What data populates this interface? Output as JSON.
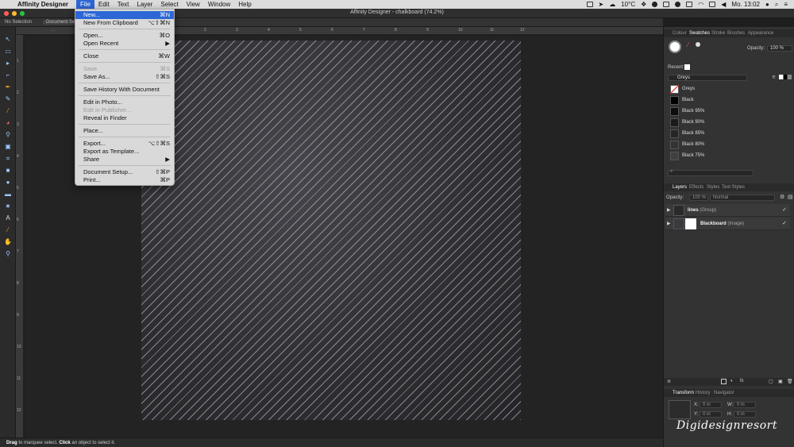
{
  "menubar": {
    "app_name": "Affinity Designer",
    "menus": [
      "File",
      "Edit",
      "Text",
      "Layer",
      "Select",
      "View",
      "Window",
      "Help"
    ],
    "temperature": "10°C",
    "clock": "Mo. 13:02"
  },
  "window": {
    "title": "Affinity Designer - chalkboard (74.2%)"
  },
  "context_toolbar": {
    "selection": "No Selection",
    "doc_setup": "Document Setup"
  },
  "file_menu": {
    "items": [
      {
        "label": "New...",
        "shortcut": "⌘N",
        "highlighted": true
      },
      {
        "label": "New From Clipboard",
        "shortcut": "⌥⇧⌘N"
      },
      {
        "label": "Open...",
        "shortcut": "⌘O"
      },
      {
        "label": "Open Recent",
        "shortcut": "▶"
      },
      {
        "label": "Close",
        "shortcut": "⌘W"
      },
      {
        "label": "Save",
        "shortcut": "⌘S",
        "disabled": true
      },
      {
        "label": "Save As...",
        "shortcut": "⇧⌘S"
      },
      {
        "label": "Save History With Document",
        "shortcut": ""
      },
      {
        "label": "Edit in Photo...",
        "shortcut": ""
      },
      {
        "label": "Edit in Publisher...",
        "shortcut": "",
        "disabled": true
      },
      {
        "label": "Reveal in Finder",
        "shortcut": ""
      },
      {
        "label": "Place...",
        "shortcut": ""
      },
      {
        "label": "Export...",
        "shortcut": "⌥⇧⌘S"
      },
      {
        "label": "Export as Template...",
        "shortcut": ""
      },
      {
        "label": "Share",
        "shortcut": "▶"
      },
      {
        "label": "Document Setup...",
        "shortcut": "⇧⌘P"
      },
      {
        "label": "Print...",
        "shortcut": "⌘P"
      }
    ]
  },
  "ruler": {
    "marks": [
      "1",
      "2",
      "3",
      "4",
      "5",
      "6",
      "7",
      "8",
      "9",
      "10",
      "11",
      "12"
    ]
  },
  "swatches_panel": {
    "tabs": [
      "Colour",
      "Swatches",
      "Stroke",
      "Brushes",
      "Appearance"
    ],
    "opacity_label": "Opacity:",
    "opacity_value": "100 %",
    "recent_label": "Recent:",
    "palette": "Greys",
    "swatches": [
      {
        "name": "Greys",
        "color": "#ffffff"
      },
      {
        "name": "Black",
        "color": "#000000"
      },
      {
        "name": "Black 95%",
        "color": "#0d0d0d"
      },
      {
        "name": "Black 90%",
        "color": "#1a1a1a"
      },
      {
        "name": "Black 85%",
        "color": "#262626"
      },
      {
        "name": "Black 80%",
        "color": "#333333"
      },
      {
        "name": "Black 75%",
        "color": "#404040"
      }
    ]
  },
  "layers_panel": {
    "tabs": [
      "Layers",
      "Effects",
      "Styles",
      "Text Styles"
    ],
    "opacity_label": "Opacity:",
    "opacity_value": "100 %",
    "blend_mode": "Normal",
    "layers": [
      {
        "name": "lines",
        "kind": "(Group)"
      },
      {
        "name": "Blackboard",
        "kind": "(Image)"
      }
    ]
  },
  "transform_panel": {
    "tabs": [
      "Transform",
      "History",
      "Navigator"
    ],
    "fields": [
      {
        "label": "X:",
        "value": "0 in"
      },
      {
        "label": "W:",
        "value": "0 in"
      },
      {
        "label": "Y:",
        "value": "0 in"
      },
      {
        "label": "H:",
        "value": "0 in"
      }
    ]
  },
  "statusbar": {
    "drag": "Drag",
    "drag_text": " to marquee select. ",
    "click": "Click",
    "click_text": " an object to select it."
  },
  "watermark": "Digidesignresort"
}
